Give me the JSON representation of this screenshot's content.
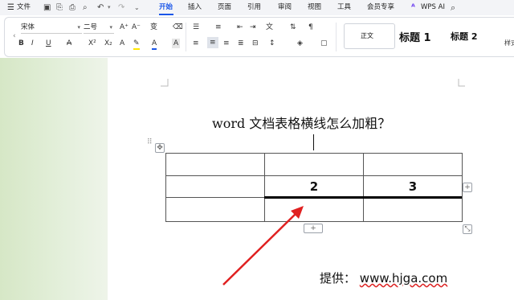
{
  "menu": {
    "file_label": "文件",
    "tabs": [
      {
        "label": "开始"
      },
      {
        "label": "插入"
      },
      {
        "label": "页面"
      },
      {
        "label": "引用"
      },
      {
        "label": "审阅"
      },
      {
        "label": "视图"
      },
      {
        "label": "工具"
      },
      {
        "label": "会员专享"
      }
    ],
    "ai_label": "WPS AI",
    "active_tab": "开始"
  },
  "toolbar": {
    "font_name": "宋体",
    "font_size": "二号",
    "styles_label": "样式",
    "style_normal": "正文",
    "style_h1": "标题  1",
    "style_h2": "标题  2"
  },
  "document": {
    "title": "word 文档表格横线怎么加粗？",
    "table": [
      [
        "",
        "",
        ""
      ],
      [
        "",
        "2",
        "3"
      ],
      [
        "",
        "",
        ""
      ]
    ],
    "credit_prefix": "提供：",
    "credit_url": "www.hjga.com"
  },
  "colors": {
    "accent": "#1a56e8",
    "arrow": "#e02020",
    "sidebar": "#dcebd0",
    "menubar": "#f3f4f7"
  }
}
